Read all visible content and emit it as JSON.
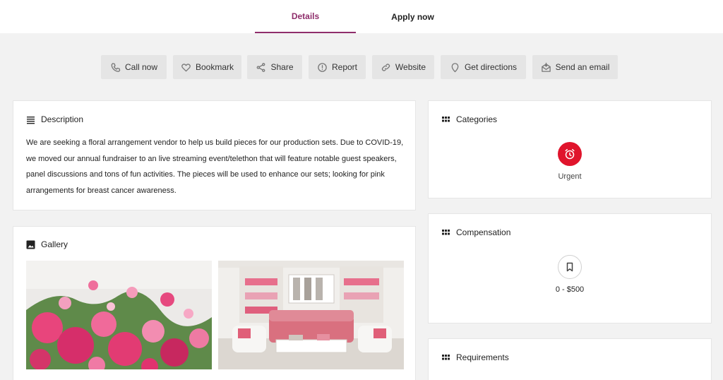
{
  "tabs": {
    "details": "Details",
    "apply": "Apply now"
  },
  "actions": {
    "call": "Call now",
    "bookmark": "Bookmark",
    "share": "Share",
    "report": "Report",
    "website": "Website",
    "directions": "Get directions",
    "email": "Send an email"
  },
  "description": {
    "title": "Description",
    "text": "We are seeking a floral arrangement vendor to help us build pieces for our production sets. Due to COVID-19, we moved our annual fundraiser to an live streaming event/telethon that will feature notable guest speakers, panel discussions and tons of fun activities. The pieces will be used to enhance our sets; looking for pink arrangements for breast cancer awareness."
  },
  "gallery": {
    "title": "Gallery"
  },
  "categories": {
    "title": "Categories",
    "item": "Urgent"
  },
  "compensation": {
    "title": "Compensation",
    "value": "0 - $500"
  },
  "requirements": {
    "title": "Requirements"
  },
  "colors": {
    "accent": "#8f2e6b",
    "urgent": "#e0142c",
    "button_bg": "#e5e5e5",
    "page_bg": "#f2f2f2"
  },
  "icons": [
    "phone-icon",
    "heart-icon",
    "share-icon",
    "alert-circle-icon",
    "link-icon",
    "map-pin-icon",
    "email-icon",
    "list-icon",
    "image-icon",
    "grid-icon",
    "alarm-clock-icon",
    "bookmark-icon"
  ]
}
